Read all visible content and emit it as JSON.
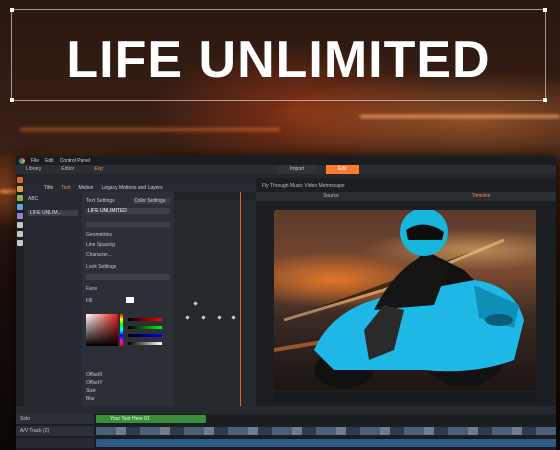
{
  "banner": {
    "title": "LIFE UNLIMITED"
  },
  "menu": [
    "File",
    "Edit",
    "Control Panel"
  ],
  "app_tabs": [
    {
      "label": "Library",
      "active": false
    },
    {
      "label": "Editor",
      "active": false
    },
    {
      "label": "Exp",
      "active": true
    }
  ],
  "right_tabs": [
    {
      "label": "Import",
      "active": false
    },
    {
      "label": "Edit",
      "active": true
    }
  ],
  "sub_tabs": [
    {
      "label": "Title",
      "active": false
    },
    {
      "label": "Text",
      "active": true
    },
    {
      "label": "Motion",
      "active": false
    },
    {
      "label": "Legacy Motions and Layers",
      "active": false
    }
  ],
  "layers": {
    "header": "ABC",
    "item": "LIFE UNLIM..."
  },
  "text_settings": {
    "header": "Text Settings",
    "color_settings": "Color Settings",
    "text_value": "LIFE UNLIMITED",
    "rows": [
      "Geometries",
      "Line Spacing",
      "Character...",
      "Look Settings",
      "Face"
    ],
    "fill": "Fill",
    "offsets": [
      "OffsetX",
      "OffsetY",
      "Size",
      "Blur"
    ]
  },
  "viewer": {
    "title": "Fly Through Music Video Metroscape",
    "tabs": [
      {
        "label": "Source",
        "active": false
      },
      {
        "label": "Timeline",
        "active": true
      }
    ]
  },
  "timeline": {
    "track_label": "A/V Track (2)",
    "solo": "Solo",
    "title_clip": "Your Text Here 01"
  }
}
